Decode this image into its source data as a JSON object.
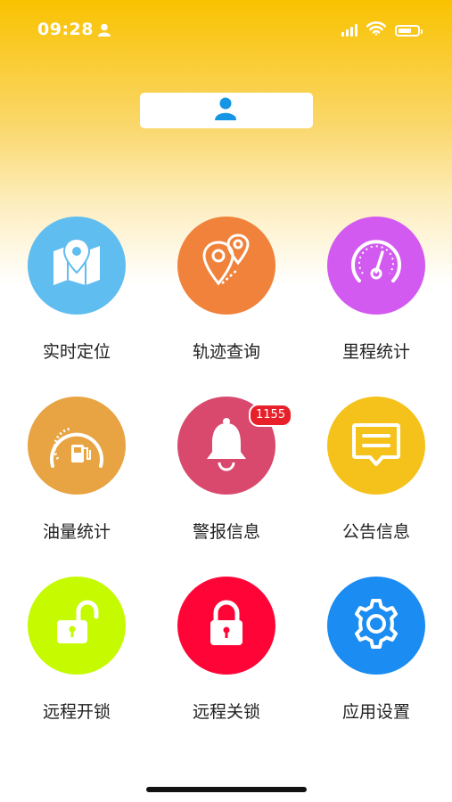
{
  "status_bar": {
    "time": "09:28",
    "battery_percent": 0.7
  },
  "grid": {
    "items": [
      {
        "label": "实时定位",
        "icon": "map-pin-icon",
        "color": "#5fbdf0"
      },
      {
        "label": "轨迹查询",
        "icon": "route-icon",
        "color": "#f0823b"
      },
      {
        "label": "里程统计",
        "icon": "speedometer-icon",
        "color": "#d25af0"
      },
      {
        "label": "油量统计",
        "icon": "fuel-gauge-icon",
        "color": "#e8a442"
      },
      {
        "label": "警报信息",
        "icon": "bell-icon",
        "color": "#d9486d",
        "badge": "1155"
      },
      {
        "label": "公告信息",
        "icon": "message-icon",
        "color": "#f5c21b"
      },
      {
        "label": "远程开锁",
        "icon": "unlock-icon",
        "color": "#c5fa00"
      },
      {
        "label": "远程关锁",
        "icon": "lock-icon",
        "color": "#ff0537"
      },
      {
        "label": "应用设置",
        "icon": "gear-icon",
        "color": "#1a8cf2"
      }
    ]
  }
}
